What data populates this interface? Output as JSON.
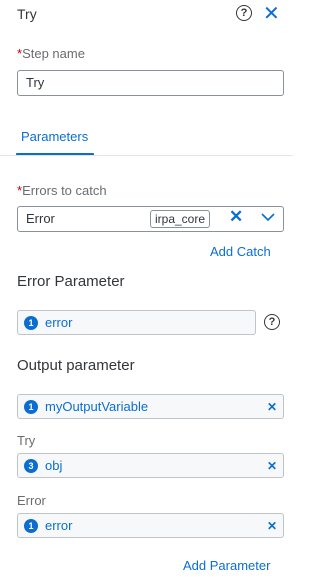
{
  "header": {
    "title": "Try"
  },
  "step_name": {
    "required_mark": "*",
    "label": "Step name",
    "value": "Try"
  },
  "tabs": [
    {
      "label": "Parameters"
    }
  ],
  "errors_to_catch": {
    "required_mark": "*",
    "label": "Errors to catch",
    "value": "Error",
    "tag": "irpa_core",
    "add_catch": "Add Catch"
  },
  "error_parameter": {
    "title": "Error Parameter",
    "token": {
      "badge": "1",
      "text": "error"
    }
  },
  "output_parameter": {
    "title": "Output parameter",
    "token": {
      "badge": "1",
      "text": "myOutputVariable"
    },
    "try": {
      "label": "Try",
      "badge": "3",
      "text": "obj"
    },
    "error": {
      "label": "Error",
      "badge": "1",
      "text": "error"
    },
    "add_parameter": "Add Parameter"
  },
  "colors": {
    "accent": "#0a6ed1",
    "required": "#bb0000",
    "text": "#32363a"
  },
  "icons": [
    "help-icon",
    "close-icon",
    "clear-icon",
    "chevron-down-icon"
  ]
}
